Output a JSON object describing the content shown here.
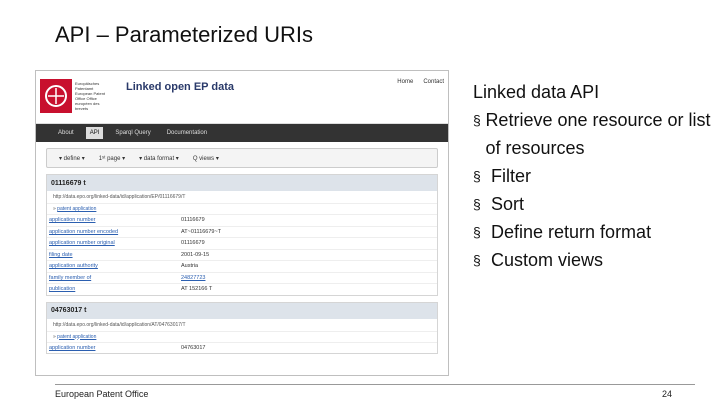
{
  "slide": {
    "title": "API – Parameterized URIs",
    "footer_left": "European Patent Office",
    "page_number": "24"
  },
  "screenshot": {
    "logo_text": "Europäisches Patentamt European Patent Office Office européen des brevets",
    "site_title": "Linked open EP data",
    "top_links": [
      "Home",
      "Contact"
    ],
    "nav": [
      "About",
      "API",
      "Sparql Query",
      "Documentation"
    ],
    "toolbar": [
      "▾ define ▾",
      "1ˢᵗ page ▾",
      "▾ data format ▾",
      "Q views ▾"
    ],
    "records": [
      {
        "id": "01116679 t",
        "uri": "http://data.epo.org/linked-data/id/application/EP/01116679/T",
        "type": "patent application",
        "rows": [
          {
            "key": "application number",
            "value": "01116679"
          },
          {
            "key": "application number encoded",
            "value": "AT~01116679~T"
          },
          {
            "key": "application number original",
            "value": "01116679"
          },
          {
            "key": "filing date",
            "value": "2001-09-15"
          },
          {
            "key": "application authority",
            "value": "Austria"
          },
          {
            "key": "family member of",
            "value": "24827723"
          },
          {
            "key": "publication",
            "value": "AT 152166 T"
          }
        ]
      },
      {
        "id": "04763017 t",
        "uri": "http://data.epo.org/linked-data/id/application/AT/04763017/T",
        "type": "patent application",
        "rows": [
          {
            "key": "application number",
            "value": "04763017"
          }
        ]
      }
    ]
  },
  "panel": {
    "title": "Linked data API",
    "bullets": [
      "Retrieve one resource or list of resources",
      "Filter",
      "Sort",
      "Define return format",
      "Custom views"
    ],
    "bullet_glyph": "§"
  }
}
